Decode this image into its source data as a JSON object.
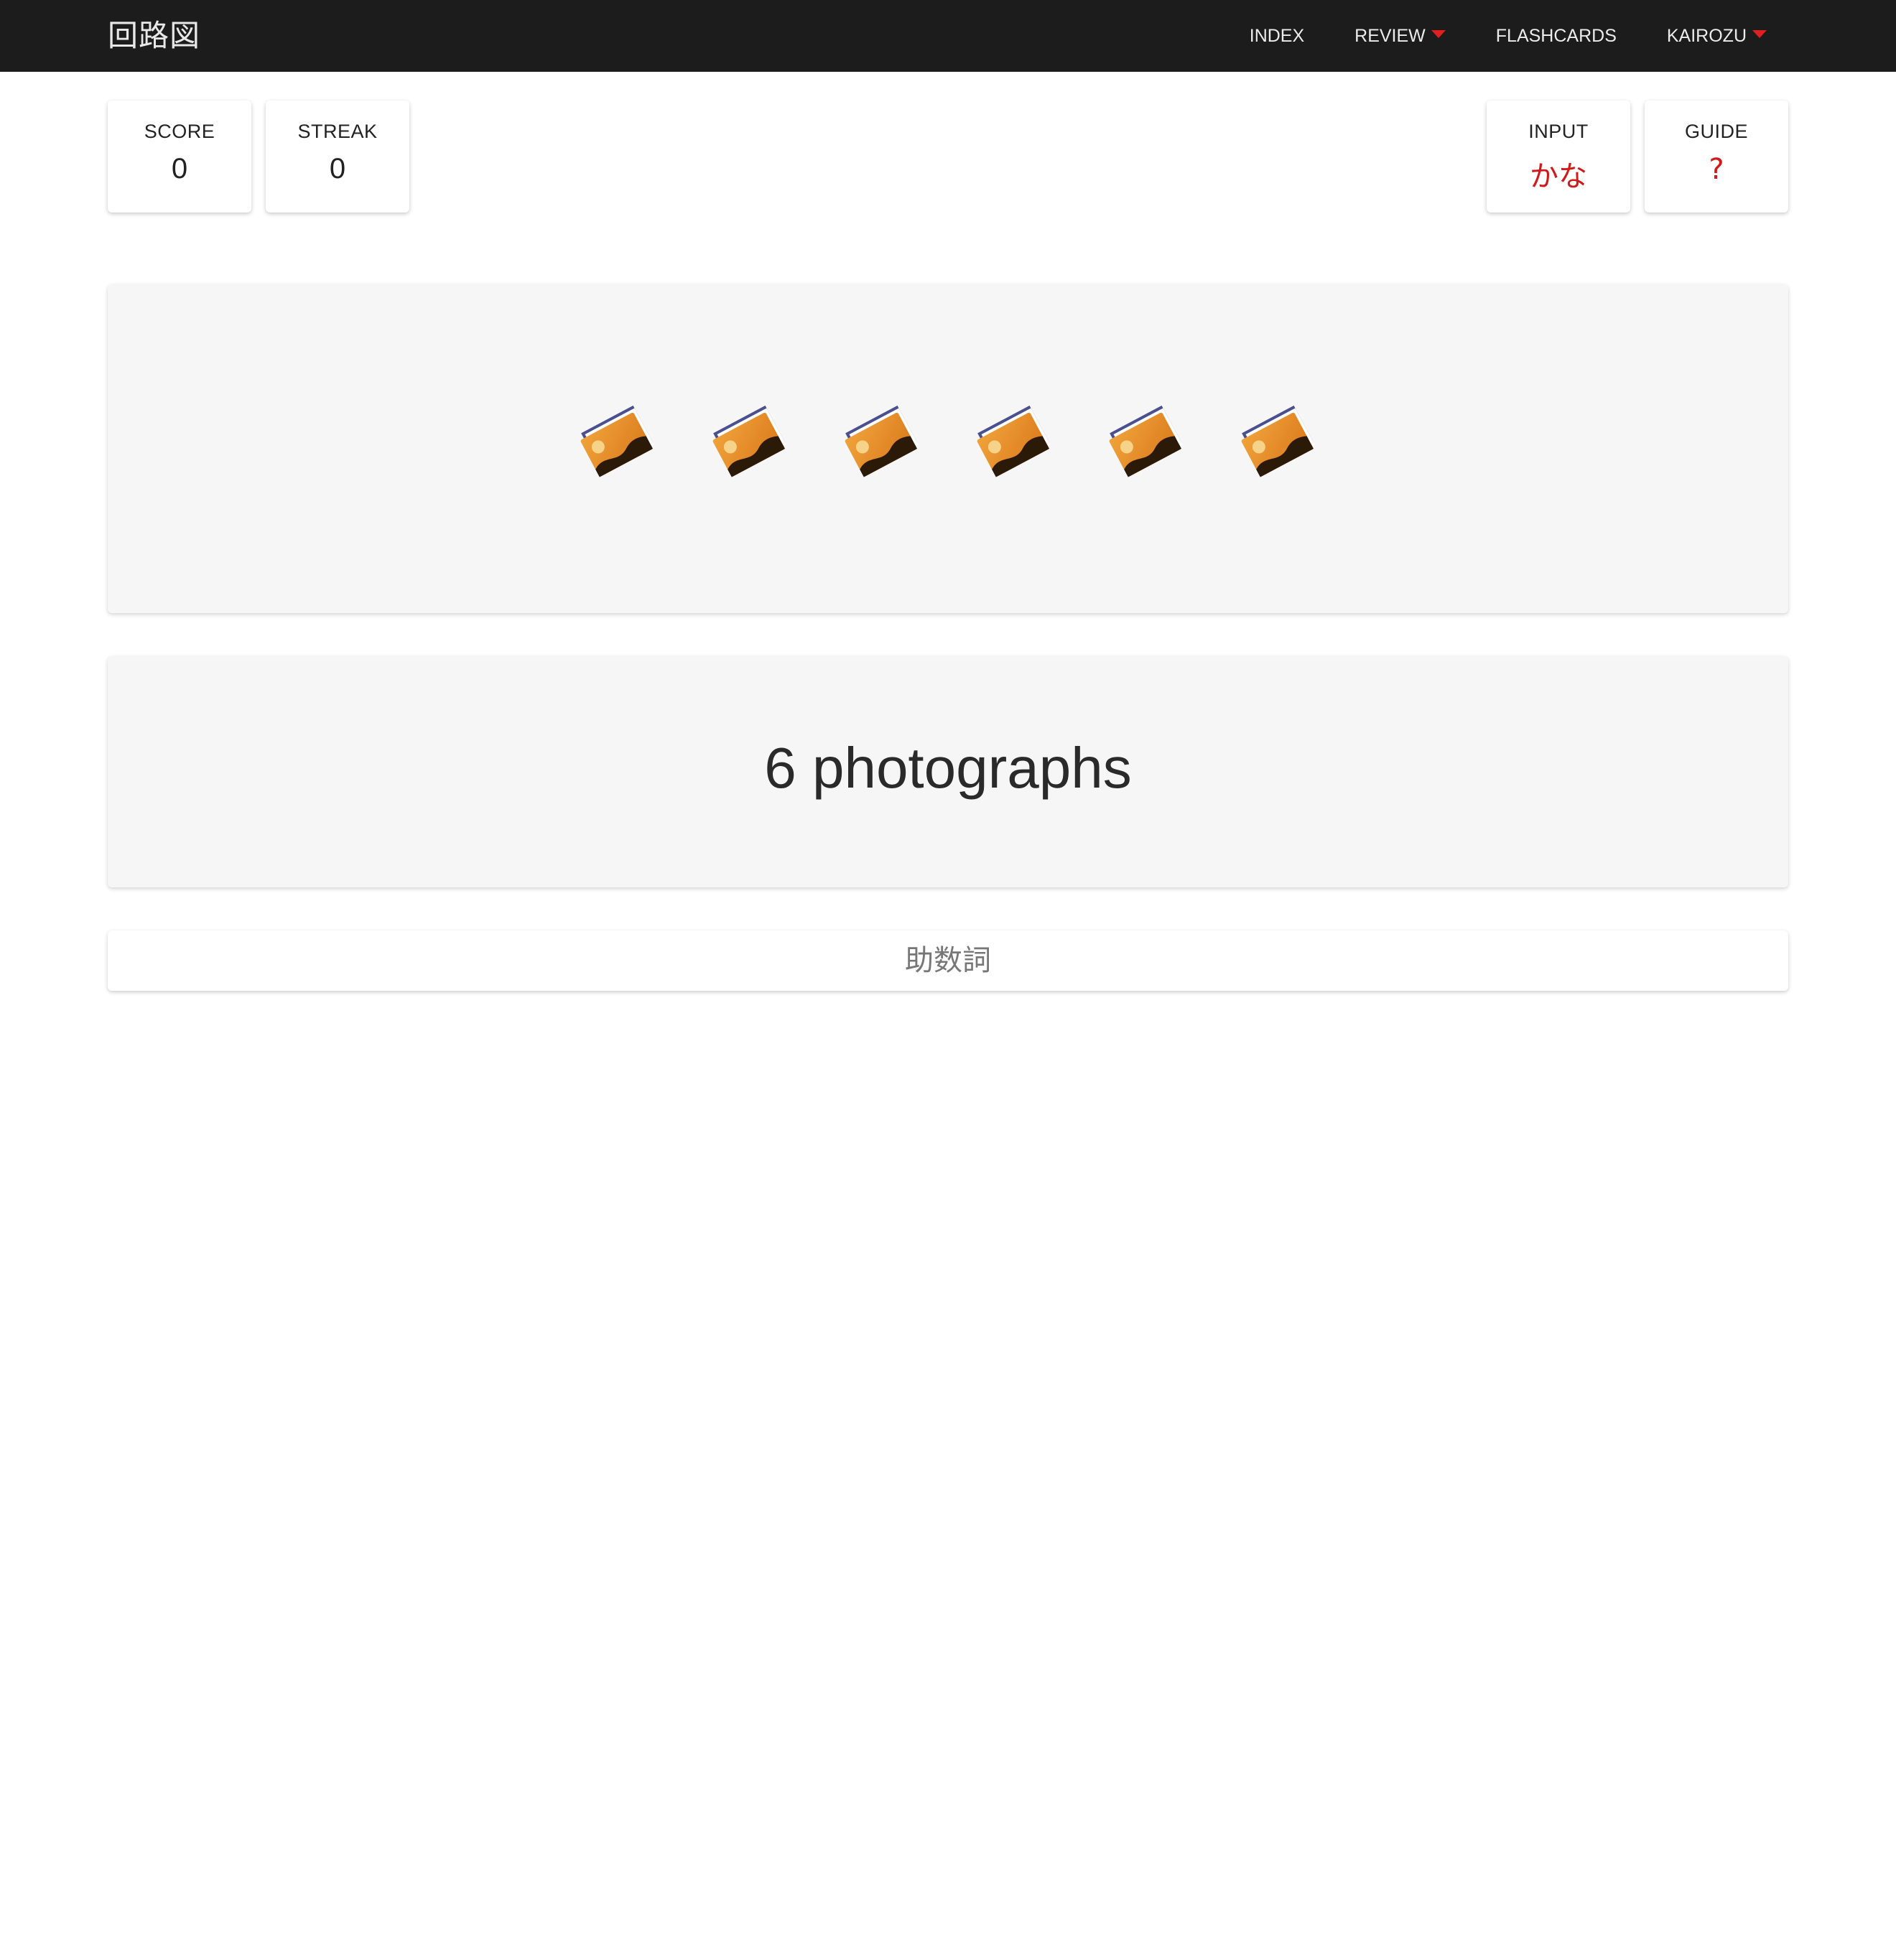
{
  "app": {
    "brand": "回路図"
  },
  "nav": {
    "items": [
      {
        "label": "INDEX",
        "dropdown": false
      },
      {
        "label": "REVIEW",
        "dropdown": true
      },
      {
        "label": "FLASHCARDS",
        "dropdown": false
      },
      {
        "label": "KAIROZU",
        "dropdown": true
      }
    ],
    "caret_color": "#e02020"
  },
  "stats": {
    "score": {
      "label": "SCORE",
      "value": "0"
    },
    "streak": {
      "label": "STREAK",
      "value": "0"
    }
  },
  "controls": {
    "input": {
      "label": "INPUT",
      "value": "かな"
    },
    "guide": {
      "label": "GUIDE",
      "value": "?"
    }
  },
  "prompt": {
    "icon": "framed-picture-icon",
    "icon_count": 6,
    "text": "6 photographs"
  },
  "hint": {
    "label": "助数詞"
  },
  "colors": {
    "navbar": "#1c1c1c",
    "accent": "#d0191a",
    "panel": "#f6f6f6"
  }
}
